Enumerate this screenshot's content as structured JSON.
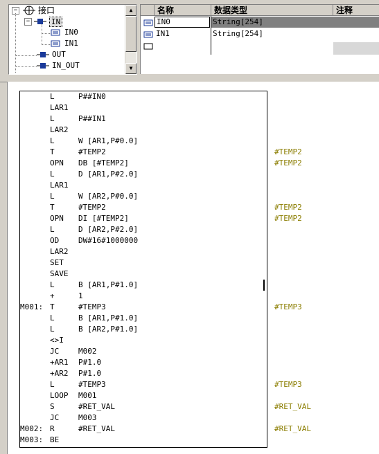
{
  "tree": {
    "root": "接口",
    "items": [
      {
        "label": "IN"
      },
      {
        "label": "IN0"
      },
      {
        "label": "IN1"
      },
      {
        "label": "OUT"
      },
      {
        "label": "IN_OUT"
      }
    ]
  },
  "grid": {
    "headers": [
      "名称",
      "数据类型",
      "注释"
    ],
    "rows": [
      {
        "name": "IN0",
        "type": "String[254]"
      },
      {
        "name": "IN1",
        "type": "String[254]"
      }
    ]
  },
  "code": [
    {
      "label": "",
      "op": "L",
      "arg": "P##IN0",
      "cmt": ""
    },
    {
      "label": "",
      "op": "LAR1",
      "arg": "",
      "cmt": ""
    },
    {
      "label": "",
      "op": "L",
      "arg": "P##IN1",
      "cmt": ""
    },
    {
      "label": "",
      "op": "LAR2",
      "arg": "",
      "cmt": ""
    },
    {
      "label": "",
      "op": "L",
      "arg": "W [AR1,P#0.0]",
      "cmt": ""
    },
    {
      "label": "",
      "op": "T",
      "arg": "#TEMP2",
      "cmt": "#TEMP2"
    },
    {
      "label": "",
      "op": "OPN",
      "arg": "DB [#TEMP2]",
      "cmt": "#TEMP2"
    },
    {
      "label": "",
      "op": "L",
      "arg": "D [AR1,P#2.0]",
      "cmt": ""
    },
    {
      "label": "",
      "op": "LAR1",
      "arg": "",
      "cmt": ""
    },
    {
      "label": "",
      "op": "L",
      "arg": "W [AR2,P#0.0]",
      "cmt": ""
    },
    {
      "label": "",
      "op": "T",
      "arg": "#TEMP2",
      "cmt": "#TEMP2"
    },
    {
      "label": "",
      "op": "OPN",
      "arg": "DI [#TEMP2]",
      "cmt": "#TEMP2"
    },
    {
      "label": "",
      "op": "L",
      "arg": "D [AR2,P#2.0]",
      "cmt": ""
    },
    {
      "label": "",
      "op": "OD",
      "arg": "DW#16#1000000",
      "cmt": ""
    },
    {
      "label": "",
      "op": "LAR2",
      "arg": "",
      "cmt": ""
    },
    {
      "label": "",
      "op": "SET",
      "arg": "",
      "cmt": ""
    },
    {
      "label": "",
      "op": "SAVE",
      "arg": "",
      "cmt": ""
    },
    {
      "label": "",
      "op": "L",
      "arg": "B [AR1,P#1.0]",
      "cmt": ""
    },
    {
      "label": "",
      "op": "+",
      "arg": "1",
      "cmt": ""
    },
    {
      "label": "M001:",
      "op": "T",
      "arg": "#TEMP3",
      "cmt": "#TEMP3"
    },
    {
      "label": "",
      "op": "L",
      "arg": "B [AR1,P#1.0]",
      "cmt": ""
    },
    {
      "label": "",
      "op": "L",
      "arg": "B [AR2,P#1.0]",
      "cmt": ""
    },
    {
      "label": "",
      "op": "<>I",
      "arg": "",
      "cmt": ""
    },
    {
      "label": "",
      "op": "JC",
      "arg": "M002",
      "cmt": ""
    },
    {
      "label": "",
      "op": "+AR1",
      "arg": "P#1.0",
      "cmt": ""
    },
    {
      "label": "",
      "op": "+AR2",
      "arg": "P#1.0",
      "cmt": ""
    },
    {
      "label": "",
      "op": "L",
      "arg": "#TEMP3",
      "cmt": "#TEMP3"
    },
    {
      "label": "",
      "op": "LOOP",
      "arg": "M001",
      "cmt": ""
    },
    {
      "label": "",
      "op": "S",
      "arg": "#RET_VAL",
      "cmt": "#RET_VAL"
    },
    {
      "label": "",
      "op": "JC",
      "arg": "M003",
      "cmt": ""
    },
    {
      "label": "M002:",
      "op": "R",
      "arg": "#RET_VAL",
      "cmt": "#RET_VAL"
    },
    {
      "label": "M003:",
      "op": "BE",
      "arg": "",
      "cmt": ""
    }
  ]
}
